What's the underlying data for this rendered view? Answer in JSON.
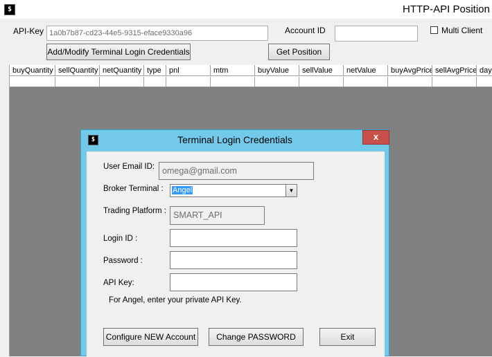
{
  "app": {
    "icon_glyph": "$",
    "title": "HTTP-API Position L"
  },
  "toolbar": {
    "api_key_label": "API-Key",
    "api_key_value": "1a0b7b87-cd23-44e5-9315-eface9330a96",
    "account_id_label": "Account ID",
    "account_id_value": "",
    "multi_client_label": "Multi Client",
    "multi_client_checked": false,
    "add_modify_button": "Add/Modify Terminal Login Credentials",
    "get_position_button": "Get Position"
  },
  "grid": {
    "columns": [
      "buyQuantity",
      "sellQuantity",
      "netQuantity",
      "type",
      "pnl",
      "mtm",
      "buyValue",
      "sellValue",
      "netValue",
      "buyAvgPrice",
      "sellAvgPrice",
      "day"
    ],
    "background": "#808080"
  },
  "dialog": {
    "icon_glyph": "$",
    "title": "Terminal Login Credentials",
    "close_label": "x",
    "titlebar_color": "#72c9ea",
    "close_color": "#c7504b",
    "email_label": "User Email ID:",
    "email_value": "omega@gmail.com",
    "broker_label": "Broker Terminal :",
    "broker_value": "Angel",
    "platform_label": "Trading Platform :",
    "platform_value": "SMART_API",
    "login_label": "Login ID :",
    "login_value": "",
    "password_label": "Password :",
    "password_value": "",
    "apikey_label": "API Key:",
    "apikey_value": "",
    "hint": "For Angel, enter your private API Key.",
    "configure_button": "Configure NEW Account",
    "change_password_button": "Change PASSWORD",
    "exit_button": "Exit"
  }
}
